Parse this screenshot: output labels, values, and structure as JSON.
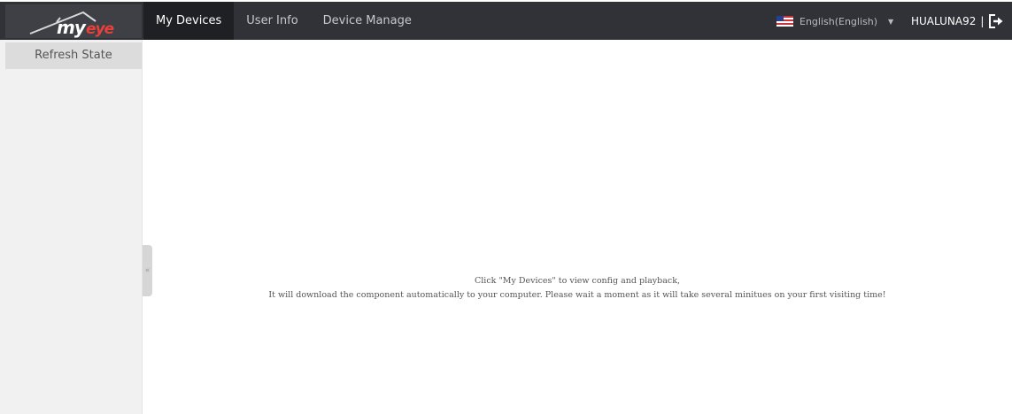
{
  "header": {
    "logo_text": "myeye",
    "nav": [
      {
        "label": "My Devices",
        "active": true
      },
      {
        "label": "User Info",
        "active": false
      },
      {
        "label": "Device Manage",
        "active": false
      }
    ],
    "language": {
      "label": "English(English)",
      "flag_icon": "us-flag-icon",
      "caret_icon": "caret-down-icon"
    },
    "user": {
      "username": "HUALUNA92",
      "separator": "|",
      "logout_icon": "logout-icon"
    }
  },
  "sidebar": {
    "refresh_label": "Refresh State",
    "collapse_icon": "double-chevron-left-icon",
    "collapse_glyph": "«"
  },
  "main": {
    "message_line1": "Click \"My Devices\" to view config and playback,",
    "message_line2": "It will download the component automatically to your computer. Please wait a moment as it will take several minitues on your first visiting time!"
  },
  "colors": {
    "topbar": "#303238",
    "active_tab": "#1f2024",
    "logo_red": "#e8403a",
    "sidebar": "#f1f1f1"
  }
}
